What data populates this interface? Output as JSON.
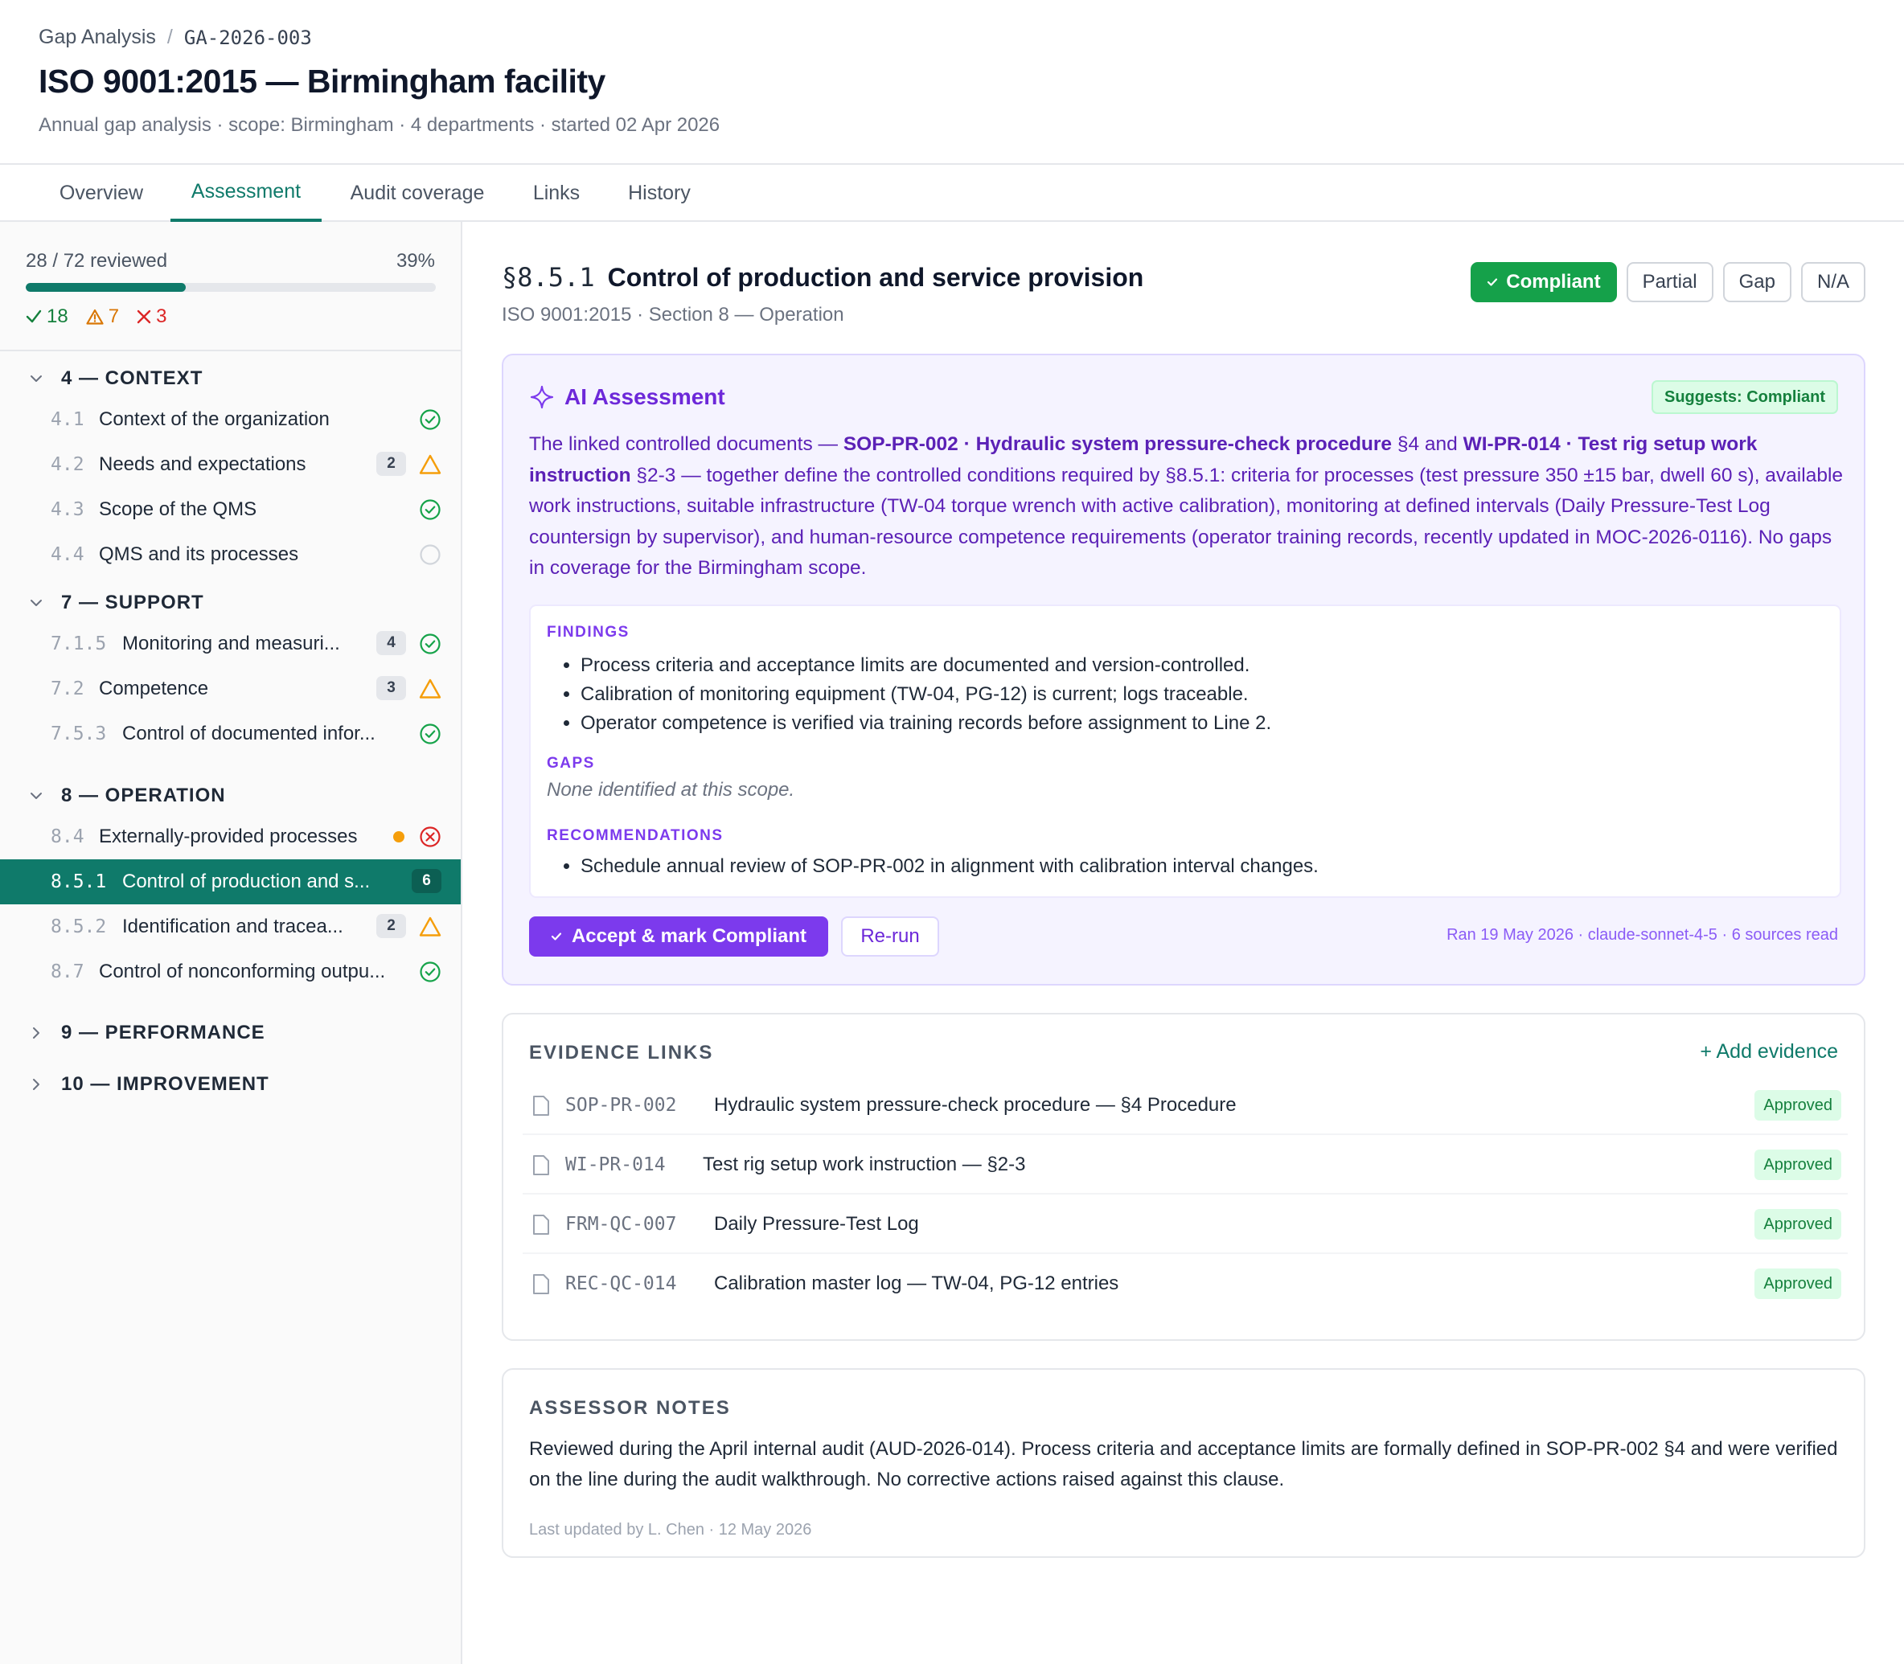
{
  "breadcrumb": {
    "parent": "Gap Analysis",
    "current": "GA-2026-003"
  },
  "page": {
    "title": "ISO 9001:2015 — Birmingham facility",
    "subtitle": "Annual gap analysis · scope: Birmingham · 4 departments · started 02 Apr 2026"
  },
  "tabs": [
    {
      "label": "Overview"
    },
    {
      "label": "Assessment",
      "active": true
    },
    {
      "label": "Audit coverage"
    },
    {
      "label": "Links"
    },
    {
      "label": "History"
    }
  ],
  "progress": {
    "label": "28 / 72 reviewed",
    "percent_label": "39%",
    "fraction": 0.39,
    "compliant": "18",
    "partial": "7",
    "gap": "3"
  },
  "sidebar": {
    "sections": [
      {
        "label": "4 — CONTEXT",
        "expanded": true,
        "items": [
          {
            "num": "4.1",
            "title": "Context of the organization",
            "status": "compliant"
          },
          {
            "num": "4.2",
            "title": "Needs and expectations",
            "badge": "2",
            "status": "partial"
          },
          {
            "num": "4.3",
            "title": "Scope of the QMS",
            "status": "compliant"
          },
          {
            "num": "4.4",
            "title": "QMS and its processes",
            "status": "not-reviewed"
          }
        ]
      },
      {
        "label": "7 — SUPPORT",
        "expanded": true,
        "items": [
          {
            "num": "7.1.5",
            "title": "Monitoring and measuri...",
            "badge": "4",
            "status": "compliant"
          },
          {
            "num": "7.2",
            "title": "Competence",
            "badge": "3",
            "status": "partial"
          },
          {
            "num": "7.5.3",
            "title": "Control of documented infor...",
            "status": "compliant"
          }
        ]
      },
      {
        "label": "8 — OPERATION",
        "expanded": true,
        "items": [
          {
            "num": "8.4",
            "title": "Externally-provided processes",
            "status": "gap",
            "dot": true
          },
          {
            "num": "8.5.1",
            "title": "Control of production and s...",
            "badge": "6",
            "selected": true
          },
          {
            "num": "8.5.2",
            "title": "Identification and tracea...",
            "badge": "2",
            "status": "partial"
          },
          {
            "num": "8.7",
            "title": "Control of nonconforming outpu...",
            "status": "compliant"
          }
        ]
      },
      {
        "label": "9 — PERFORMANCE",
        "expanded": false
      },
      {
        "label": "10 — IMPROVEMENT",
        "expanded": false
      }
    ]
  },
  "clause": {
    "number": "§8.5.1",
    "title": "Control of production and service provision",
    "subtitle": "ISO 9001:2015 · Section 8 — Operation"
  },
  "status_buttons": {
    "compliant": "Compliant",
    "partial": "Partial",
    "gap": "Gap",
    "na": "N/A"
  },
  "ai": {
    "title": "AI Assessment",
    "suggestion": "Suggests: Compliant",
    "text_1": "The linked controlled documents — ",
    "doc_1": "SOP-PR-002 · Hydraulic system pressure-check procedure",
    "text_2": " §4 and ",
    "doc_2": "WI-PR-014 · Test rig setup work instruction",
    "text_3": " §2-3 — together define the controlled conditions required by §8.5.1: criteria for processes (test pressure 350 ±15 bar, dwell 60 s), available work instructions, suitable infrastructure (TW-04 torque wrench with active calibration), monitoring at defined intervals (Daily Pressure-Test Log countersign by supervisor), and human-resource competence requirements (operator training records, recently updated in MOC-2026-0116). No gaps in coverage for the Birmingham scope.",
    "findings_label": "FINDINGS",
    "findings": [
      "Process criteria and acceptance limits are documented and version-controlled.",
      "Calibration of monitoring equipment (TW-04, PG-12) is current; logs traceable.",
      "Operator competence is verified via training records before assignment to Line 2."
    ],
    "gaps_label": "GAPS",
    "gaps_none": "None identified at this scope.",
    "recommendations_label": "RECOMMENDATIONS",
    "recommendations": [
      "Schedule annual review of SOP-PR-002 in alignment with calibration interval changes."
    ],
    "accept_label": "Accept & mark Compliant",
    "rerun_label": "Re-run",
    "meta": "Ran 19 May 2026 · claude-sonnet-4-5 · 6 sources read"
  },
  "evidence": {
    "heading": "EVIDENCE LINKS",
    "add_label": "+ Add evidence",
    "items": [
      {
        "code": "SOP-PR-002",
        "title": "Hydraulic system pressure-check procedure — §4 Procedure",
        "status": "Approved"
      },
      {
        "code": "WI-PR-014",
        "title": "Test rig setup work instruction — §2-3",
        "status": "Approved"
      },
      {
        "code": "FRM-QC-007",
        "title": "Daily Pressure-Test Log",
        "status": "Approved"
      },
      {
        "code": "REC-QC-014",
        "title": "Calibration master log — TW-04, PG-12 entries",
        "status": "Approved"
      }
    ]
  },
  "notes": {
    "heading": "ASSESSOR NOTES",
    "text": "Reviewed during the April internal audit (AUD-2026-014). Process criteria and acceptance limits are formally defined in SOP-PR-002 §4 and were verified on the line during the audit walkthrough. No corrective actions raised against this clause.",
    "meta": "Last updated by L. Chen · 12 May 2026"
  },
  "colors": {
    "accent": "#0f7a6a",
    "compliant": "#16a34a",
    "partial": "#f59e0b",
    "gap": "#dc2626",
    "ai": "#7c3aed"
  }
}
